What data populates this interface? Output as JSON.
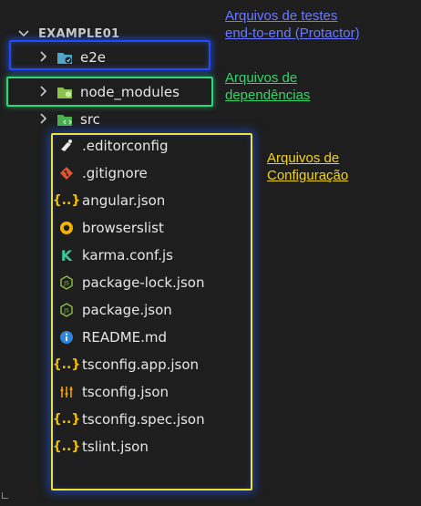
{
  "explorer": {
    "root_label": "EXAMPLE01",
    "folders": [
      {
        "label": "e2e",
        "icon": "e2e-folder-icon",
        "color": "#4fa6c6"
      },
      {
        "label": "node_modules",
        "icon": "node-modules-folder-icon",
        "color": "#8bc34a"
      },
      {
        "label": "src",
        "icon": "src-folder-icon",
        "color": "#4caf50"
      }
    ],
    "files": [
      {
        "label": ".editorconfig",
        "icon": "editorconfig-icon"
      },
      {
        "label": ".gitignore",
        "icon": "git-icon"
      },
      {
        "label": "angular.json",
        "icon": "json-braces-icon"
      },
      {
        "label": "browserslist",
        "icon": "browserslist-icon"
      },
      {
        "label": "karma.conf.js",
        "icon": "karma-icon"
      },
      {
        "label": "package-lock.json",
        "icon": "nodejs-icon"
      },
      {
        "label": "package.json",
        "icon": "nodejs-icon"
      },
      {
        "label": "README.md",
        "icon": "info-icon"
      },
      {
        "label": "tsconfig.app.json",
        "icon": "json-braces-icon"
      },
      {
        "label": "tsconfig.json",
        "icon": "tsconfig-icon"
      },
      {
        "label": "tsconfig.spec.json",
        "icon": "json-braces-icon"
      },
      {
        "label": "tslint.json",
        "icon": "json-braces-icon"
      }
    ]
  },
  "annotations": {
    "e2e_note": [
      "Arquivos de testes",
      "end-to-end (Protactor)"
    ],
    "deps_note": [
      "Arquivos de",
      "dependências"
    ],
    "config_note": [
      "Arquivos de",
      "Configuração"
    ]
  },
  "colors": {
    "blue_box": "#1e4bff",
    "green_box": "#2bd97a",
    "yellow_box": "#f0e030",
    "note_blue": "#6a79ff",
    "note_green": "#35d46e",
    "note_yellow": "#f0d51b"
  }
}
